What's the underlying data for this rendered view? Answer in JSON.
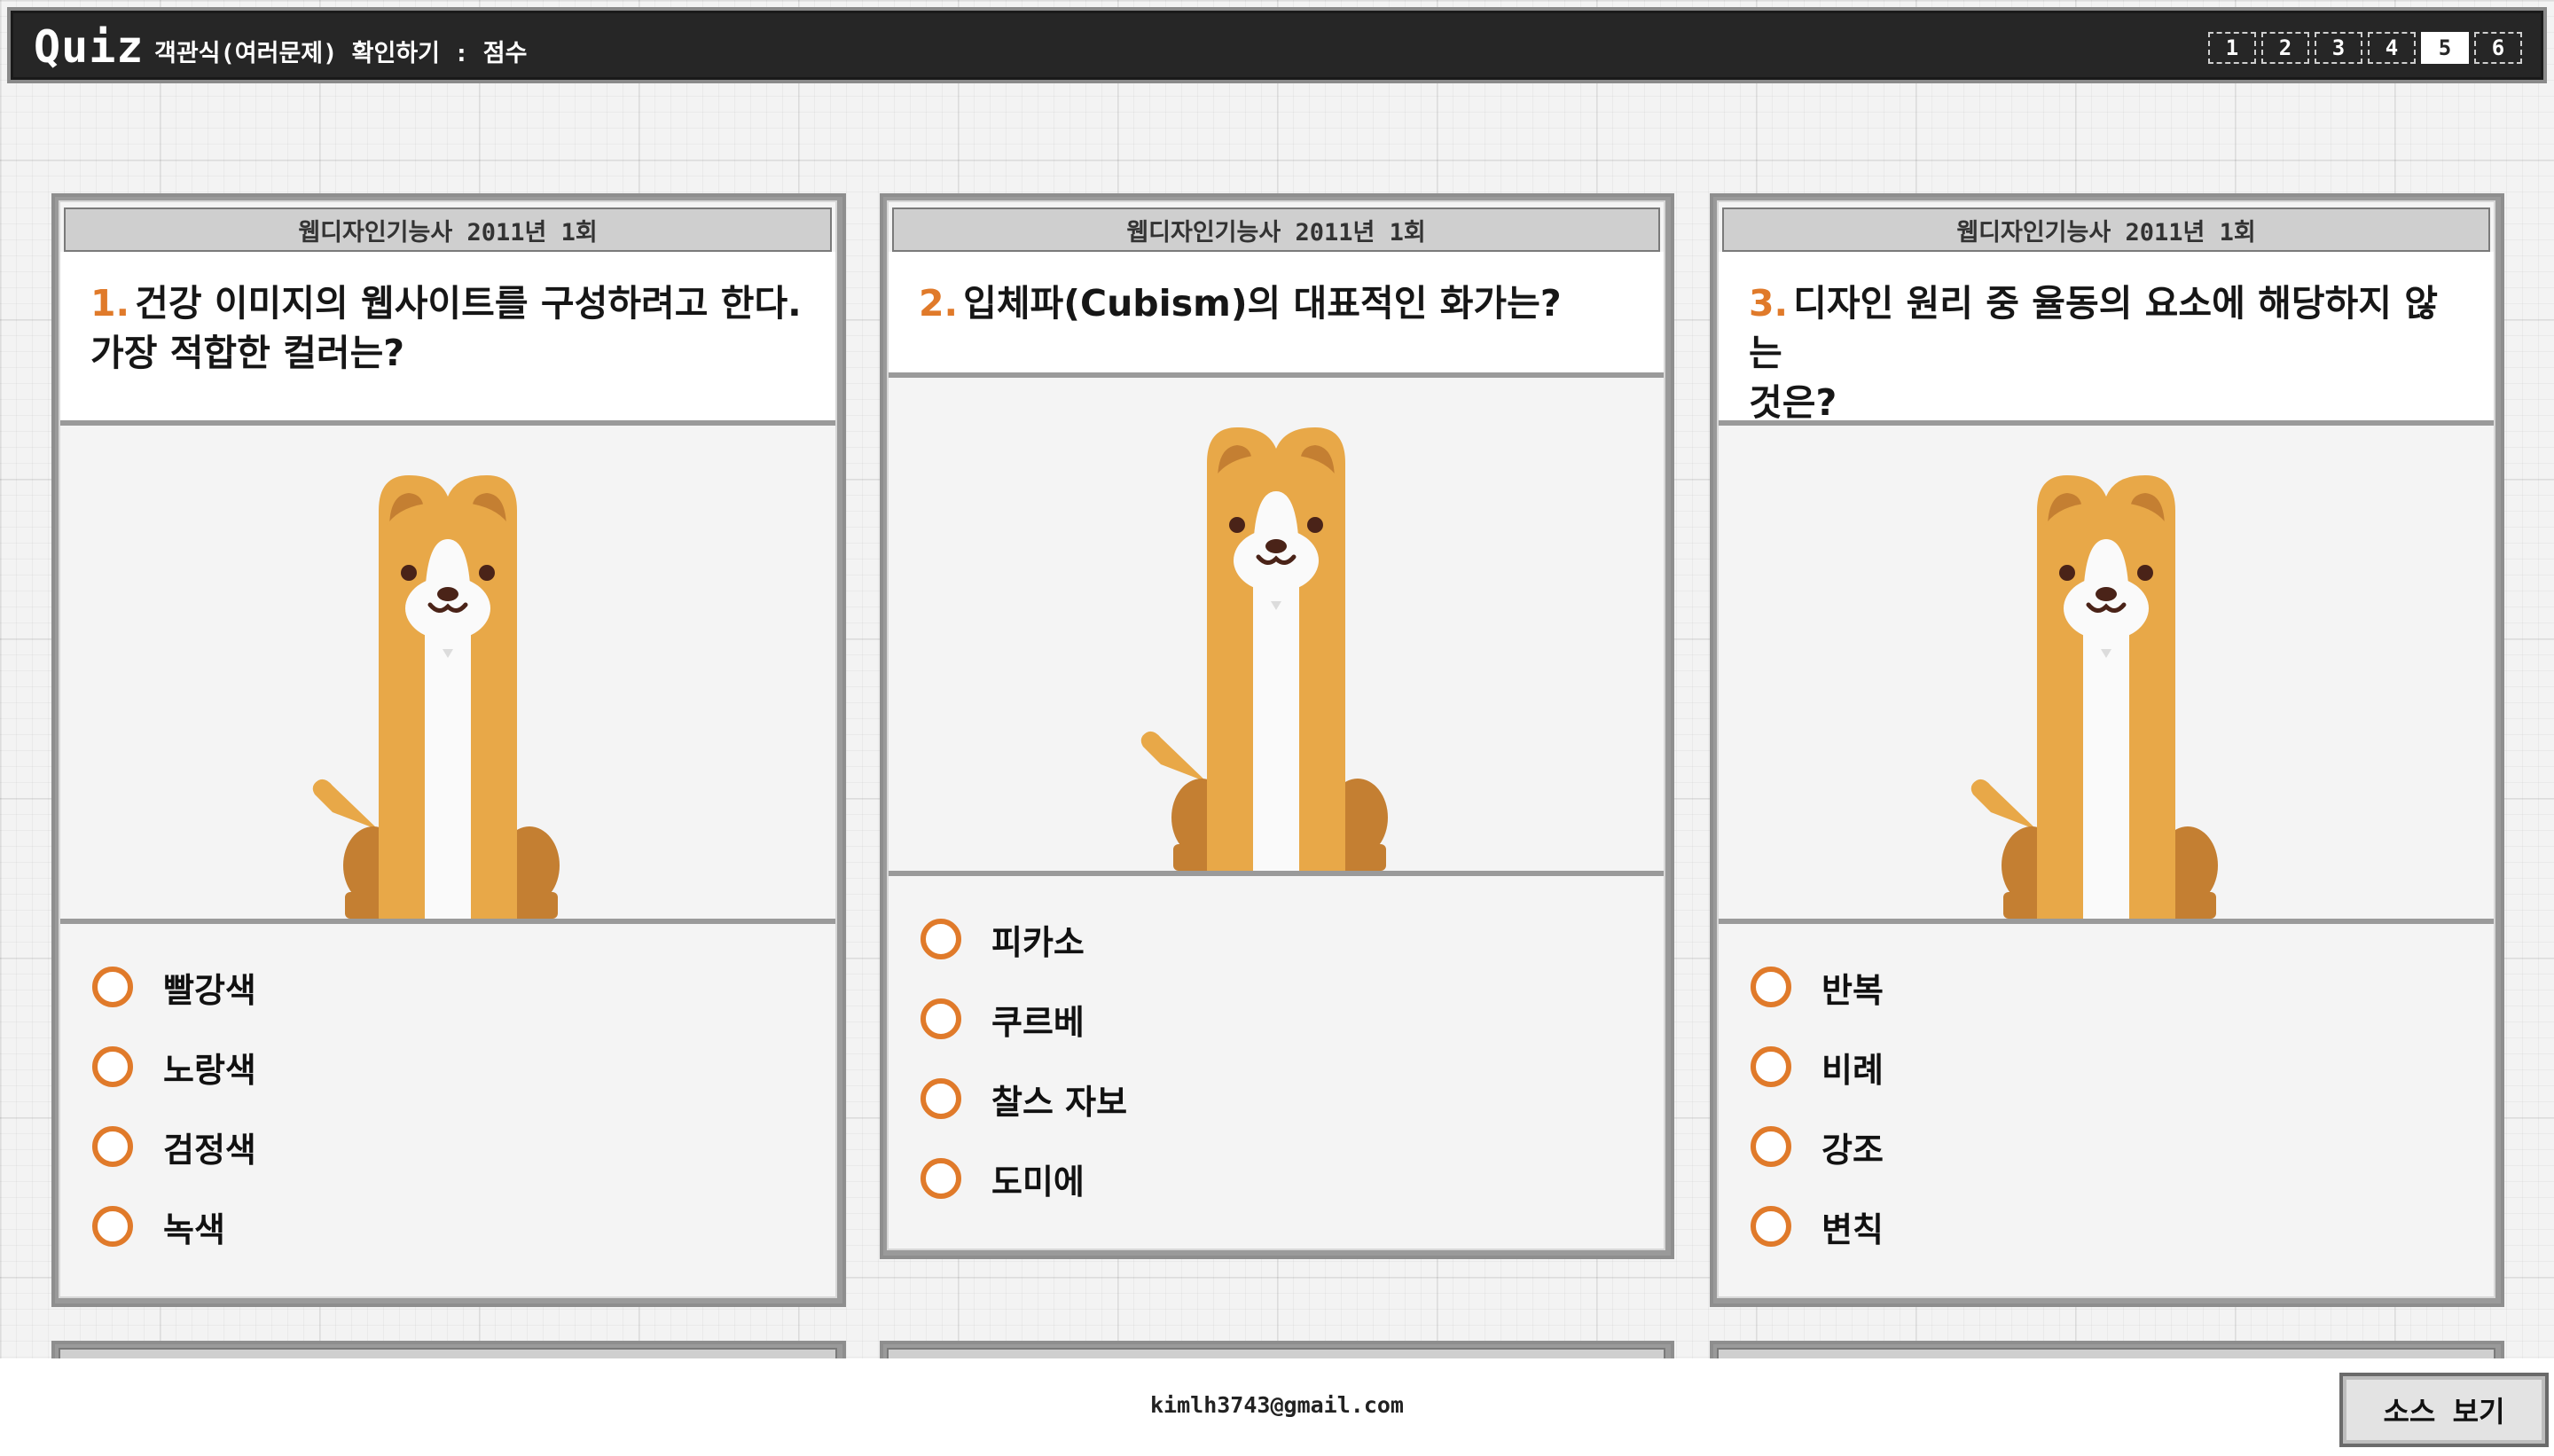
{
  "header": {
    "logo": "Quiz",
    "subtitle": "객관식(여러문제) 확인하기 : 점수",
    "pages": [
      "1",
      "2",
      "3",
      "4",
      "5",
      "6"
    ],
    "active_page": "5"
  },
  "cards": [
    {
      "category": "웹디자인기능사 2011년 1회",
      "number": "1.",
      "question_line1": "건강 이미지의 웹사이트를 구성하려고 한다.",
      "question_line2": "가장 적합한 컬러는?",
      "options": [
        "빨강색",
        "노랑색",
        "검정색",
        "녹색"
      ]
    },
    {
      "category": "웹디자인기능사 2011년 1회",
      "number": "2.",
      "question_line1": "입체파(Cubism)의 대표적인 화가는?",
      "question_line2": "",
      "options": [
        "피카소",
        "쿠르베",
        "찰스 자보",
        "도미에"
      ]
    },
    {
      "category": "웹디자인기능사 2011년 1회",
      "number": "3.",
      "question_line1": "디자인 원리 중 율동의 요소에 해당하지 않는",
      "question_line2": "것은?",
      "options": [
        "반복",
        "비례",
        "강조",
        "변칙"
      ]
    }
  ],
  "colors": {
    "accent": "#e07a2a",
    "dog_body": "#e8a848",
    "dog_dark": "#c47f32",
    "header_bg": "#262626"
  },
  "icons": [
    "dog-illustration",
    "radio-icon"
  ],
  "footer": {
    "email": "kimlh3743@gmail.com",
    "source_button": "소스 보기"
  }
}
